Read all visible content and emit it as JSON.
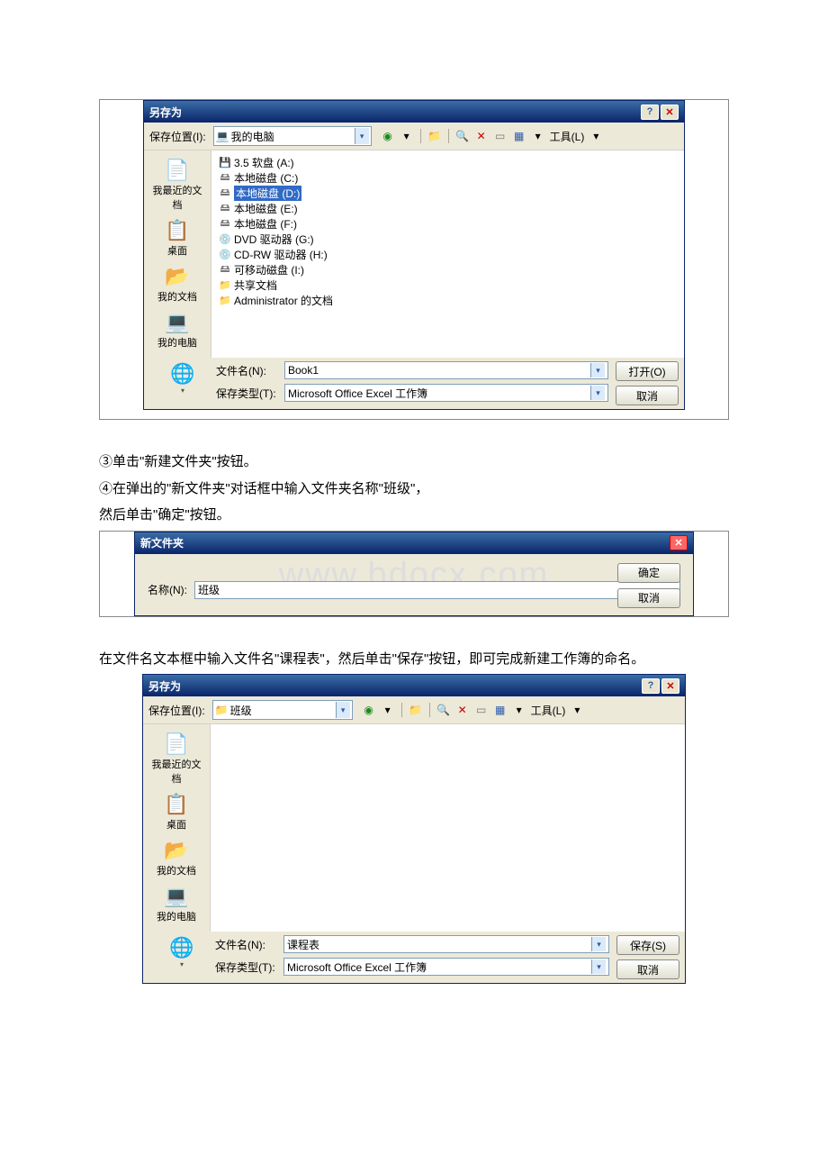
{
  "dlg1": {
    "title": "另存为",
    "loc_label": "保存位置(I):",
    "loc_value": "我的电脑",
    "tools_label": "工具(L)",
    "places": [
      {
        "label": "我最近的文档",
        "icon": "📄"
      },
      {
        "label": "桌面",
        "icon": "📋"
      },
      {
        "label": "我的文档",
        "icon": "📂"
      },
      {
        "label": "我的电脑",
        "icon": "💻"
      }
    ],
    "files": [
      {
        "icon": "💾",
        "name": "3.5 软盘 (A:)"
      },
      {
        "icon": "🖴",
        "name": "本地磁盘 (C:)"
      },
      {
        "icon": "🖴",
        "name": "本地磁盘 (D:)",
        "selected": true
      },
      {
        "icon": "🖴",
        "name": "本地磁盘 (E:)"
      },
      {
        "icon": "🖴",
        "name": "本地磁盘 (F:)"
      },
      {
        "icon": "💿",
        "name": "DVD 驱动器 (G:)"
      },
      {
        "icon": "💿",
        "name": "CD-RW 驱动器 (H:)"
      },
      {
        "icon": "🖴",
        "name": "可移动磁盘 (I:)"
      },
      {
        "icon": "📁",
        "name": "共享文档"
      },
      {
        "icon": "📁",
        "name": "Administrator 的文档"
      }
    ],
    "fn_label": "文件名(N):",
    "fn_value": "Book1",
    "ft_label": "保存类型(T):",
    "ft_value": "Microsoft Office Excel 工作簿",
    "open_btn": "打开(O)",
    "cancel_btn": "取消"
  },
  "text1": "③单击\"新建文件夹\"按钮。",
  "text2": "④在弹出的\"新文件夹\"对话框中输入文件夹名称\"班级\"，",
  "text3": "然后单击\"确定\"按钮。",
  "nf": {
    "title": "新文件夹",
    "name_label": "名称(N):",
    "name_value": "班级",
    "ok": "确定",
    "cancel": "取消",
    "watermark": "www.bdocx.com"
  },
  "text4": "在文件名文本框中输入文件名\"课程表\"，然后单击\"保存\"按钮，即可完成新建工作簿的命名。",
  "dlg2": {
    "title": "另存为",
    "loc_label": "保存位置(I):",
    "loc_value": "班级",
    "tools_label": "工具(L)",
    "places": [
      {
        "label": "我最近的文档",
        "icon": "📄"
      },
      {
        "label": "桌面",
        "icon": "📋"
      },
      {
        "label": "我的文档",
        "icon": "📂"
      },
      {
        "label": "我的电脑",
        "icon": "💻"
      }
    ],
    "fn_label": "文件名(N):",
    "fn_value": "课程表",
    "ft_label": "保存类型(T):",
    "ft_value": "Microsoft Office Excel 工作簿",
    "save_btn": "保存(S)",
    "cancel_btn": "取消"
  }
}
